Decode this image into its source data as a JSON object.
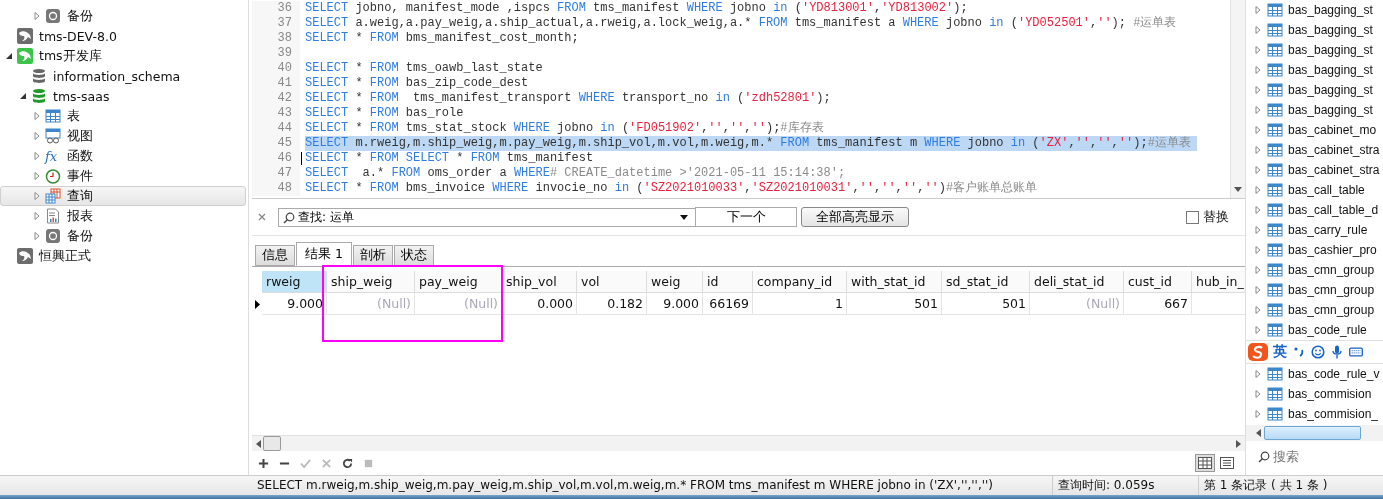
{
  "tree": {
    "above": [
      {
        "label": "备份",
        "kind": "backup"
      }
    ],
    "connections": [
      {
        "label": "tms-DEV-8.0",
        "open": false,
        "expanded": false
      },
      {
        "label": "tms开发库",
        "open": true,
        "expanded": true,
        "children": [
          {
            "label": "information_schema",
            "open": false,
            "expanded": false
          },
          {
            "label": "tms-saas",
            "open": true,
            "expanded": true,
            "children": [
              {
                "label": "表",
                "kind": "table",
                "selected": false
              },
              {
                "label": "视图",
                "kind": "view",
                "selected": false
              },
              {
                "label": "函数",
                "kind": "function",
                "glyph": "fx",
                "selected": false
              },
              {
                "label": "事件",
                "kind": "event",
                "selected": false
              },
              {
                "label": "查询",
                "kind": "query",
                "selected": true
              },
              {
                "label": "报表",
                "kind": "report",
                "selected": false
              },
              {
                "label": "备份",
                "kind": "backup",
                "selected": false
              }
            ]
          }
        ]
      },
      {
        "label": "恒興正式",
        "open": false,
        "expanded": false
      }
    ]
  },
  "editor": {
    "lines": [
      {
        "number": "36",
        "selected": false,
        "cursor": false,
        "tokens": [
          {
            "kind": "keyword",
            "text": "SELECT"
          },
          {
            "kind": "plain",
            "text": " jobno, manifest_mode ,ispcs "
          },
          {
            "kind": "keyword",
            "text": "FROM"
          },
          {
            "kind": "plain",
            "text": " tms_manifest "
          },
          {
            "kind": "keyword",
            "text": "WHERE"
          },
          {
            "kind": "plain",
            "text": " jobno "
          },
          {
            "kind": "keyword",
            "text": "in"
          },
          {
            "kind": "plain",
            "text": " ("
          },
          {
            "kind": "string",
            "text": "'YD813001'"
          },
          {
            "kind": "plain",
            "text": ","
          },
          {
            "kind": "string",
            "text": "'YD813002'"
          },
          {
            "kind": "plain",
            "text": ");"
          }
        ]
      },
      {
        "number": "37",
        "selected": false,
        "cursor": false,
        "tokens": [
          {
            "kind": "keyword",
            "text": "SELECT"
          },
          {
            "kind": "plain",
            "text": " a.weig,a.pay_weig,a.ship_actual,a.rweig,a.lock_weig,a.* "
          },
          {
            "kind": "keyword",
            "text": "FROM"
          },
          {
            "kind": "plain",
            "text": " tms_manifest a "
          },
          {
            "kind": "keyword",
            "text": "WHERE"
          },
          {
            "kind": "plain",
            "text": " jobno "
          },
          {
            "kind": "keyword",
            "text": "in"
          },
          {
            "kind": "plain",
            "text": " ("
          },
          {
            "kind": "string",
            "text": "'YD052501'"
          },
          {
            "kind": "plain",
            "text": ","
          },
          {
            "kind": "string",
            "text": "''"
          },
          {
            "kind": "plain",
            "text": "); "
          },
          {
            "kind": "comment",
            "text": "#运单表"
          }
        ]
      },
      {
        "number": "38",
        "selected": false,
        "cursor": false,
        "tokens": [
          {
            "kind": "keyword",
            "text": "SELECT"
          },
          {
            "kind": "plain",
            "text": " * "
          },
          {
            "kind": "keyword",
            "text": "FROM"
          },
          {
            "kind": "plain",
            "text": " bms_manifest_cost_month;"
          }
        ]
      },
      {
        "number": "39",
        "selected": false,
        "cursor": false
      },
      {
        "number": "40",
        "selected": false,
        "cursor": false,
        "tokens": [
          {
            "kind": "keyword",
            "text": "SELECT"
          },
          {
            "kind": "plain",
            "text": " * "
          },
          {
            "kind": "keyword",
            "text": "FROM"
          },
          {
            "kind": "plain",
            "text": " tms_oawb_last_state"
          }
        ]
      },
      {
        "number": "41",
        "selected": false,
        "cursor": false,
        "tokens": [
          {
            "kind": "keyword",
            "text": "SELECT"
          },
          {
            "kind": "plain",
            "text": " * "
          },
          {
            "kind": "keyword",
            "text": "FROM"
          },
          {
            "kind": "plain",
            "text": " bas_zip_code_dest"
          }
        ]
      },
      {
        "number": "42",
        "selected": false,
        "cursor": false,
        "tokens": [
          {
            "kind": "keyword",
            "text": "SELECT"
          },
          {
            "kind": "plain",
            "text": " * "
          },
          {
            "kind": "keyword",
            "text": "FROM"
          },
          {
            "kind": "plain",
            "text": "  tms_manifest_transport "
          },
          {
            "kind": "keyword",
            "text": "WHERE"
          },
          {
            "kind": "plain",
            "text": " transport_no "
          },
          {
            "kind": "keyword",
            "text": "in"
          },
          {
            "kind": "plain",
            "text": " ("
          },
          {
            "kind": "string",
            "text": "'zdh52801'"
          },
          {
            "kind": "plain",
            "text": ");"
          }
        ]
      },
      {
        "number": "43",
        "selected": false,
        "cursor": false,
        "tokens": [
          {
            "kind": "keyword",
            "text": "SELECT"
          },
          {
            "kind": "plain",
            "text": " * "
          },
          {
            "kind": "keyword",
            "text": "FROM"
          },
          {
            "kind": "plain",
            "text": " bas_role"
          }
        ]
      },
      {
        "number": "44",
        "selected": false,
        "cursor": false,
        "tokens": [
          {
            "kind": "keyword",
            "text": "SELECT"
          },
          {
            "kind": "plain",
            "text": " * "
          },
          {
            "kind": "keyword",
            "text": "FROM"
          },
          {
            "kind": "plain",
            "text": " tms_stat_stock "
          },
          {
            "kind": "keyword",
            "text": "WHERE"
          },
          {
            "kind": "plain",
            "text": " jobno "
          },
          {
            "kind": "keyword",
            "text": "in"
          },
          {
            "kind": "plain",
            "text": " ("
          },
          {
            "kind": "string",
            "text": "'FD051902'"
          },
          {
            "kind": "plain",
            "text": ","
          },
          {
            "kind": "string",
            "text": "''"
          },
          {
            "kind": "plain",
            "text": ","
          },
          {
            "kind": "string",
            "text": "''"
          },
          {
            "kind": "plain",
            "text": ","
          },
          {
            "kind": "string",
            "text": "''"
          },
          {
            "kind": "plain",
            "text": ");"
          },
          {
            "kind": "comment",
            "text": "#库存表"
          }
        ]
      },
      {
        "number": "45",
        "selected": true,
        "cursor": false,
        "tokens": [
          {
            "kind": "keyword",
            "text": "SELECT"
          },
          {
            "kind": "plain",
            "text": " m.rweig,m.ship_weig,m.pay_weig,m.ship_vol,m.vol,m.weig,m.* "
          },
          {
            "kind": "keyword",
            "text": "FROM"
          },
          {
            "kind": "plain",
            "text": " tms_manifest m "
          },
          {
            "kind": "keyword",
            "text": "WHERE"
          },
          {
            "kind": "plain",
            "text": " jobno "
          },
          {
            "kind": "keyword",
            "text": "in"
          },
          {
            "kind": "plain",
            "text": " ("
          },
          {
            "kind": "string",
            "text": "'ZX'"
          },
          {
            "kind": "plain",
            "text": ","
          },
          {
            "kind": "string",
            "text": "''"
          },
          {
            "kind": "plain",
            "text": ","
          },
          {
            "kind": "string",
            "text": "''"
          },
          {
            "kind": "plain",
            "text": ","
          },
          {
            "kind": "string",
            "text": "''"
          },
          {
            "kind": "plain",
            "text": ");"
          },
          {
            "kind": "comment",
            "text": "#运单表"
          }
        ]
      },
      {
        "number": "46",
        "selected": false,
        "cursor": true,
        "tokens": [
          {
            "kind": "keyword",
            "text": "SELECT"
          },
          {
            "kind": "plain",
            "text": " * "
          },
          {
            "kind": "keyword",
            "text": "FROM"
          },
          {
            "kind": "keyword",
            "text": " SELECT"
          },
          {
            "kind": "plain",
            "text": " * "
          },
          {
            "kind": "keyword",
            "text": "FROM"
          },
          {
            "kind": "plain",
            "text": " tms_manifest"
          }
        ]
      },
      {
        "number": "47",
        "selected": false,
        "cursor": false,
        "tokens": [
          {
            "kind": "keyword",
            "text": "SELECT"
          },
          {
            "kind": "plain",
            "text": "  a.* "
          },
          {
            "kind": "keyword",
            "text": "FROM"
          },
          {
            "kind": "plain",
            "text": " oms_order a "
          },
          {
            "kind": "keyword",
            "text": "WHERE"
          },
          {
            "kind": "comment",
            "text": "# CREATE_datetime >'2021-05-11 15:14:38';"
          }
        ]
      },
      {
        "number": "48",
        "selected": false,
        "cursor": false,
        "tokens": [
          {
            "kind": "keyword",
            "text": "SELECT"
          },
          {
            "kind": "plain",
            "text": " * "
          },
          {
            "kind": "keyword",
            "text": "FROM"
          },
          {
            "kind": "plain",
            "text": " bms_invoice "
          },
          {
            "kind": "keyword",
            "text": "WHERE"
          },
          {
            "kind": "plain",
            "text": " invocie_no "
          },
          {
            "kind": "keyword",
            "text": "in"
          },
          {
            "kind": "plain",
            "text": " ("
          },
          {
            "kind": "string",
            "text": "'SZ2021010033'"
          },
          {
            "kind": "plain",
            "text": ","
          },
          {
            "kind": "string",
            "text": "'SZ2021010031'"
          },
          {
            "kind": "plain",
            "text": ","
          },
          {
            "kind": "string",
            "text": "''"
          },
          {
            "kind": "plain",
            "text": ","
          },
          {
            "kind": "string",
            "text": "''"
          },
          {
            "kind": "plain",
            "text": ","
          },
          {
            "kind": "string",
            "text": "''"
          },
          {
            "kind": "plain",
            "text": ","
          },
          {
            "kind": "string",
            "text": "''"
          },
          {
            "kind": "plain",
            "text": ")"
          },
          {
            "kind": "comment",
            "text": "#客户账单总账单"
          }
        ]
      }
    ]
  },
  "find_bar": {
    "value": "查找: 运单",
    "buttons": [
      "下一个",
      "全部高亮显示"
    ],
    "replace": {
      "label": "替换",
      "checked": false
    }
  },
  "tabs": [
    {
      "label": "信息",
      "selected": false
    },
    {
      "label": "结果 1",
      "selected": true
    },
    {
      "label": "剖析",
      "selected": false
    },
    {
      "label": "状态",
      "selected": false
    }
  ],
  "table": {
    "columns": [
      {
        "label": "rweig",
        "selected": true
      },
      {
        "label": "ship_weig",
        "selected": false
      },
      {
        "label": "pay_weig",
        "selected": false
      },
      {
        "label": "ship_vol",
        "selected": false
      },
      {
        "label": "vol",
        "selected": false
      },
      {
        "label": "weig",
        "selected": false
      },
      {
        "label": "id",
        "selected": false
      },
      {
        "label": "company_id",
        "selected": false
      },
      {
        "label": "with_stat_id",
        "selected": false
      },
      {
        "label": "sd_stat_id",
        "selected": false
      },
      {
        "label": "deli_stat_id",
        "selected": false
      },
      {
        "label": "cust_id",
        "selected": false
      },
      {
        "label": "hub_in_",
        "selected": false
      }
    ],
    "rows": [
      {
        "current": true,
        "cells": [
          {
            "text": "9.000",
            "null": false
          },
          {
            "text": "(Null)",
            "null": true
          },
          {
            "text": "(Null)",
            "null": true
          },
          {
            "text": "0.000",
            "null": false
          },
          {
            "text": "0.182",
            "null": false
          },
          {
            "text": "9.000",
            "null": false
          },
          {
            "text": "66169",
            "null": false
          },
          {
            "text": "1",
            "null": false
          },
          {
            "text": "501",
            "null": false
          },
          {
            "text": "501",
            "null": false
          },
          {
            "text": "(Null)",
            "null": true
          },
          {
            "text": "667",
            "null": false
          }
        ]
      }
    ]
  },
  "view_modes": [
    {
      "kind": "grid",
      "selected": true
    },
    {
      "kind": "form",
      "selected": false
    }
  ],
  "object_list": {
    "items": [
      "bas_bagging_st",
      "bas_bagging_st",
      "bas_bagging_st",
      "bas_bagging_st",
      "bas_bagging_st",
      "bas_bagging_st",
      "bas_cabinet_mo",
      "bas_cabinet_stra",
      "bas_cabinet_stra",
      "bas_call_table",
      "bas_call_table_d",
      "bas_carry_rule",
      "bas_cashier_pro",
      "bas_cmn_group",
      "bas_cmn_group",
      "bas_cmn_group",
      "bas_code_rule"
    ],
    "items_below": [
      "bas_code_rule_v",
      "bas_commision",
      "bas_commision_"
    ],
    "search_placeholder": "搜索"
  },
  "ime_bar": {
    "mode": "英"
  },
  "status_bar": {
    "sql": "SELECT m.rweig,m.ship_weig,m.pay_weig,m.ship_vol,m.vol,m.weig,m.* FROM tms_manifest m WHERE jobno in ('ZX','','','')",
    "query_time": "查询时间: 0.059s",
    "record": "第 1 条记录 ( 共 1 条 )"
  }
}
